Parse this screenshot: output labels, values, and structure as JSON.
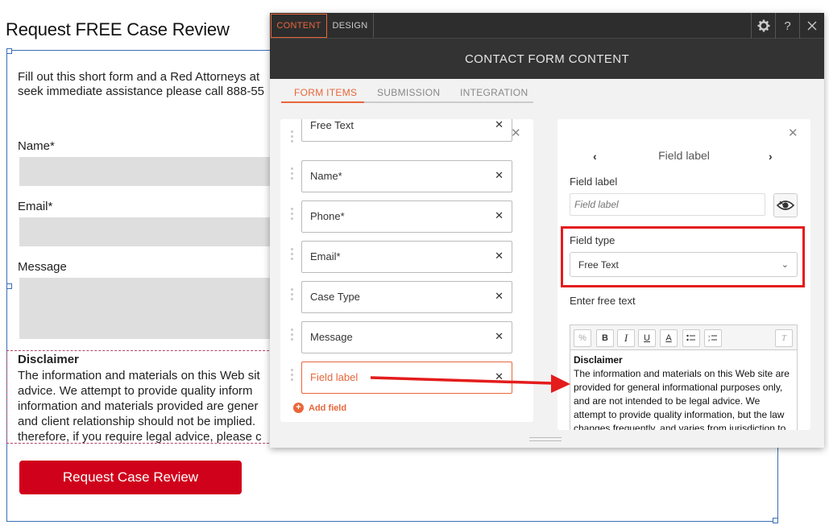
{
  "page": {
    "title": "Request FREE Case Review",
    "intro_line1": "Fill out this short form and a Red Attorneys at",
    "intro_line2": "seek immediate assistance please call 888-55",
    "name_label": "Name*",
    "email_label": "Email*",
    "message_label": "Message",
    "disclaimer_title": "Disclaimer",
    "disclaimer_lines": [
      "The information and materials on this Web sit",
      "advice. We attempt to provide quality inform",
      "information and materials provided are gener",
      "and client relationship should not be implied.",
      "therefore, if you require legal advice, please c"
    ],
    "submit_label": "Request Case Review"
  },
  "modal": {
    "tabs": [
      "CONTENT",
      "DESIGN"
    ],
    "help_label": "?",
    "header": "CONTACT FORM CONTENT",
    "subtabs": [
      "FORM ITEMS",
      "SUBMISSION",
      "INTEGRATION"
    ],
    "form_items": [
      {
        "label": "Free Text"
      },
      {
        "label": "Name*"
      },
      {
        "label": "Phone*"
      },
      {
        "label": "Email*"
      },
      {
        "label": "Case Type"
      },
      {
        "label": "Message"
      },
      {
        "label": "Field label"
      }
    ],
    "add_field_label": "Add field",
    "right": {
      "nav_title": "Field label",
      "field_label_label": "Field label",
      "field_label_placeholder": "Field label",
      "field_type_label": "Field type",
      "field_type_value": "Free Text",
      "free_text_label": "Enter free text",
      "editor_title": "Disclaimer",
      "editor_lines": [
        "The information and materials on this Web site are",
        "provided for general informational purposes only,",
        "and are not intended to be legal advice. We",
        "attempt to provide quality information, but the law",
        "changes frequently, and varies from jurisdiction to"
      ]
    }
  },
  "colors": {
    "accent": "#e8663a",
    "highlight": "#e41c1c",
    "button": "#d0021b"
  }
}
